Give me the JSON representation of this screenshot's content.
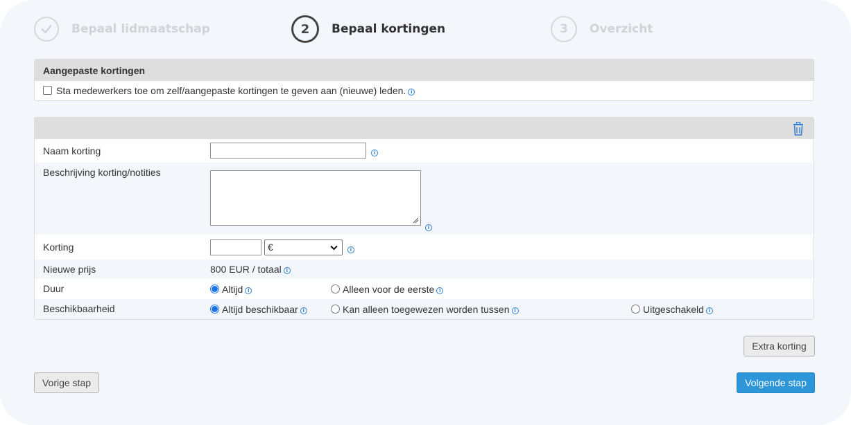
{
  "steps": [
    {
      "number": "",
      "label": "Bepaal lidmaatschap",
      "state": "done"
    },
    {
      "number": "2",
      "label": "Bepaal kortingen",
      "state": "active"
    },
    {
      "number": "3",
      "label": "Overzicht",
      "state": "upcoming"
    }
  ],
  "custom_discounts": {
    "title": "Aangepaste kortingen",
    "checkbox_label": "Sta medewerkers toe om zelf/aangepaste kortingen te geven aan (nieuwe) leden.",
    "checked": false
  },
  "discount_form": {
    "name": {
      "label": "Naam korting",
      "value": ""
    },
    "description": {
      "label": "Beschrijving korting/notities",
      "value": ""
    },
    "discount": {
      "label": "Korting",
      "value": "",
      "unit_selected": "€"
    },
    "new_price": {
      "label": "Nieuwe prijs",
      "value": "800 EUR / totaal"
    },
    "duration": {
      "label": "Duur",
      "options": [
        {
          "label": "Altijd",
          "selected": true
        },
        {
          "label": "Alleen voor de eerste",
          "selected": false
        }
      ]
    },
    "availability": {
      "label": "Beschikbaarheid",
      "options": [
        {
          "label": "Altijd beschikbaar",
          "selected": true
        },
        {
          "label": "Kan alleen toegewezen worden tussen",
          "selected": false
        },
        {
          "label": "Uitgeschakeld",
          "selected": false
        }
      ]
    }
  },
  "buttons": {
    "extra_discount": "Extra korting",
    "previous": "Vorige stap",
    "next": "Volgende stap"
  },
  "colors": {
    "accent": "#2d96d9",
    "radio_selected": "#1a73e8",
    "info_icon": "#2d7fd0"
  }
}
